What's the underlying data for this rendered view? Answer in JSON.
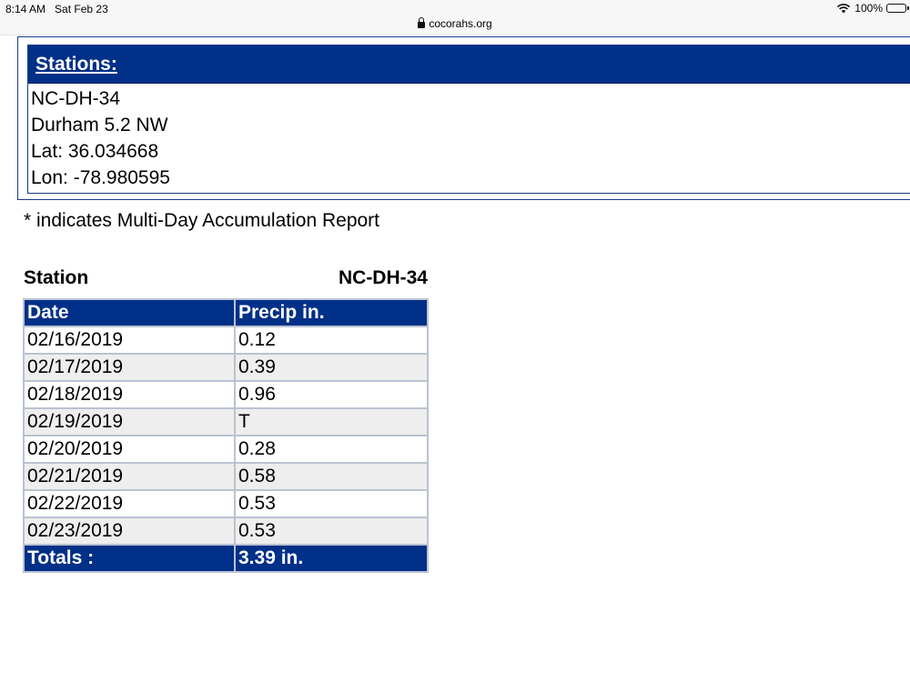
{
  "status_bar": {
    "time": "8:14 AM",
    "date": "Sat Feb 23",
    "url": "cocorahs.org",
    "battery": "100%"
  },
  "stations": {
    "title": "Stations:",
    "id": "NC-DH-34",
    "name": "Durham 5.2 NW",
    "lat": "Lat: 36.034668",
    "lon": "Lon: -78.980595"
  },
  "note": "* indicates Multi-Day Accumulation Report",
  "station_row": {
    "label": "Station",
    "value": "NC-DH-34"
  },
  "table": {
    "headers": [
      "Date",
      "Precip in."
    ],
    "rows": [
      [
        "02/16/2019",
        "0.12"
      ],
      [
        "02/17/2019",
        "0.39"
      ],
      [
        "02/18/2019",
        "0.96"
      ],
      [
        "02/19/2019",
        "T"
      ],
      [
        "02/20/2019",
        "0.28"
      ],
      [
        "02/21/2019",
        "0.58"
      ],
      [
        "02/22/2019",
        "0.53"
      ],
      [
        "02/23/2019",
        "0.53"
      ]
    ],
    "totals_label": "Totals :",
    "totals_value": "3.39 in."
  },
  "colors": {
    "header_blue": "#003087",
    "border_gray": "#b9c3d2",
    "stripe_gray": "#eeeeee"
  }
}
